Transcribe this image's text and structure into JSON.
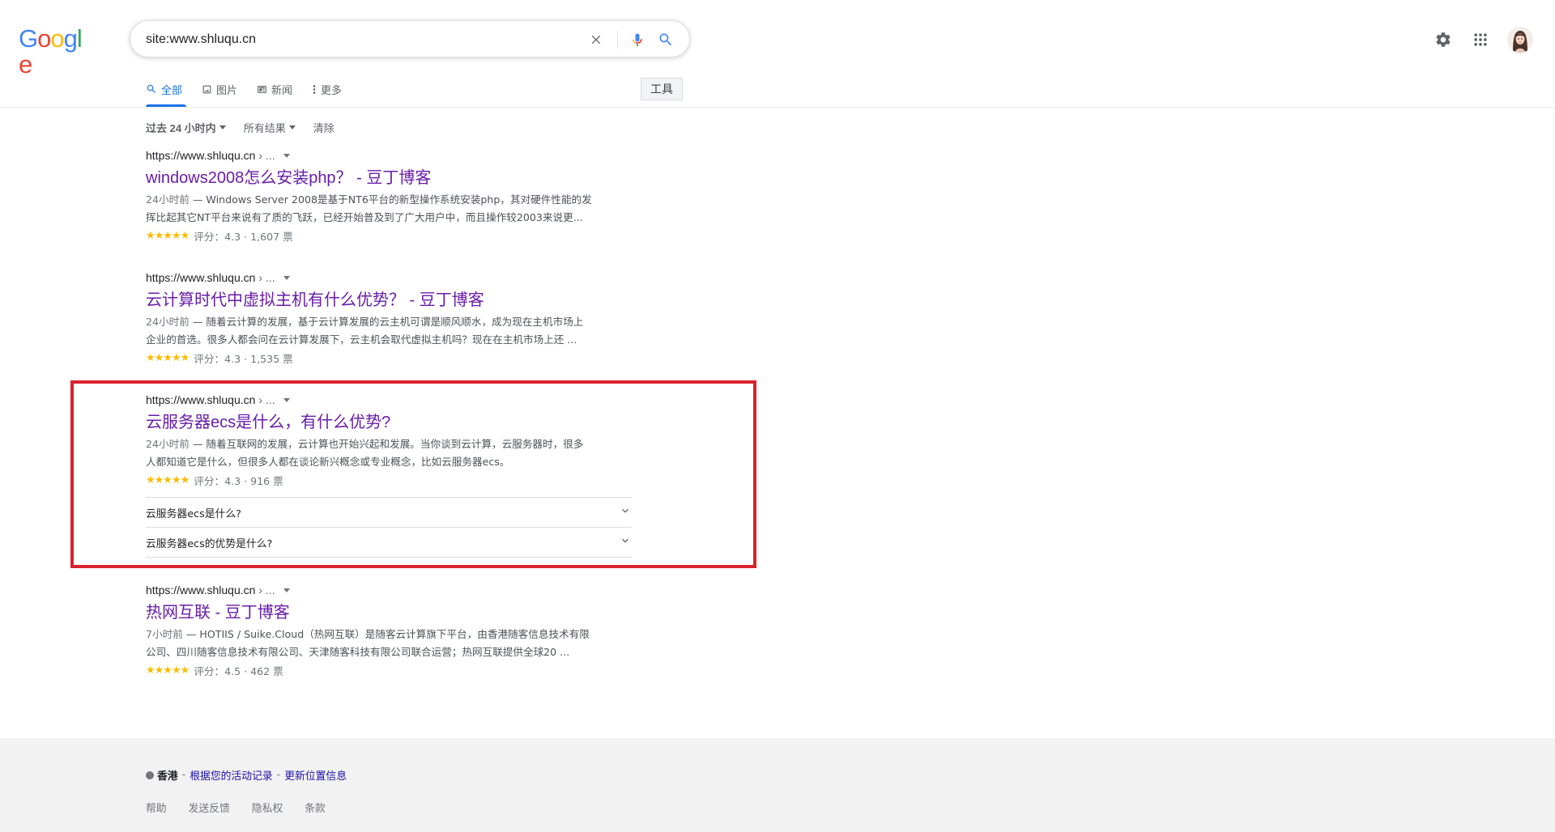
{
  "search": {
    "query": "site:www.shluqu.cn",
    "clear_icon": "close-icon",
    "mic_icon": "microphone-icon",
    "search_icon": "search-icon"
  },
  "header": {
    "logo": "Google",
    "settings_icon": "gear-icon",
    "apps_icon": "apps-grid-icon",
    "avatar": "user-avatar"
  },
  "tabs": [
    {
      "label": "全部",
      "icon": "search-icon",
      "active": true
    },
    {
      "label": "图片",
      "icon": "image-icon",
      "active": false
    },
    {
      "label": "新闻",
      "icon": "news-icon",
      "active": false
    },
    {
      "label": "更多",
      "icon": "more-vert-icon",
      "active": false
    }
  ],
  "tools_label": "工具",
  "filters": {
    "time": "过去 24 小时内",
    "results": "所有结果",
    "clear": "清除"
  },
  "results": [
    {
      "url": "https://www.shluqu.cn",
      "path": "› ...",
      "title": "windows2008怎么安装php？ - 豆丁博客",
      "date": "24小时前",
      "snippet_line1": " — Windows Server 2008是基于NT6平台的新型操作系统安装php，其对硬件性能的发",
      "snippet_line2": "挥比起其它NT平台来说有了质的飞跃，已经开始普及到了广大用户中，而且操作较2003来说更...",
      "stars": "★★★★★",
      "rating": "评分：4.3 · 1,607 票"
    },
    {
      "url": "https://www.shluqu.cn",
      "path": "› ...",
      "title": "云计算时代中虚拟主机有什么优势？ - 豆丁博客",
      "date": "24小时前",
      "snippet_line1": " — 随着云计算的发展，基于云计算发展的云主机可谓是顺风顺水，成为现在主机市场上",
      "snippet_line2": "企业的首选。很多人都会问在云计算发展下，云主机会取代虚拟主机吗？现在在主机市场上还 ...",
      "stars": "★★★★★",
      "rating": "评分：4.3 · 1,535 票"
    },
    {
      "url": "https://www.shluqu.cn",
      "path": "› ...",
      "title": "云服务器ecs是什么，有什么优势?",
      "date": "24小时前",
      "snippet_line1": " — 随着互联网的发展，云计算也开始兴起和发展。当你谈到云计算，云服务器时，很多",
      "snippet_line2": "人都知道它是什么，但很多人都在谈论新兴概念或专业概念，比如云服务器ecs。",
      "stars": "★★★★★",
      "rating": "评分：4.3 · 916 票",
      "faqs": [
        "云服务器ecs是什么?",
        "云服务器ecs的优势是什么?"
      ]
    },
    {
      "url": "https://www.shluqu.cn",
      "path": "› ...",
      "title": "热网互联 - 豆丁博客",
      "date": "7小时前",
      "snippet_line1": " — HOTIIS / Suike.Cloud（热网互联）是随客云计算旗下平台，由香港随客信息技术有限",
      "snippet_line2": "公司、四川随客信息技术有限公司、天津随客科技有限公司联合运营；热网互联提供全球20 ...",
      "stars": "★★★★★",
      "rating": "评分：4.5 · 462 票"
    }
  ],
  "footer": {
    "location": "香港",
    "sep1": "-",
    "activity_link": "根据您的活动记录",
    "sep2": "-",
    "update_link": "更新位置信息",
    "links": [
      "帮助",
      "发送反馈",
      "隐私权",
      "条款"
    ]
  },
  "colors": {
    "link_visited": "#681da8",
    "accent": "#1a73e8",
    "highlight": "#d9232e",
    "stars": "#fbbc04"
  }
}
